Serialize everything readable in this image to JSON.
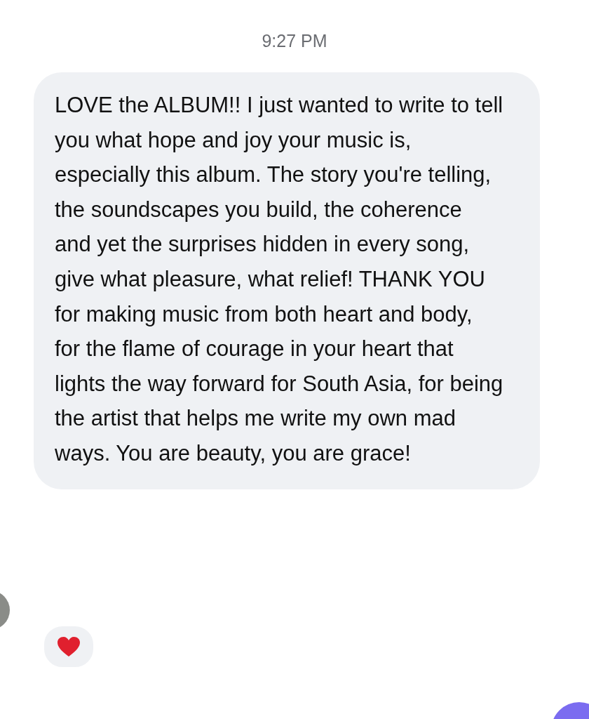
{
  "timestamp": "9:27 PM",
  "message": {
    "text": "LOVE the ALBUM!! I just wanted to write to tell you what hope and joy your music is, especially this album. The story you're telling, the soundscapes you build, the coherence and yet the surprises hidden in every song, give what pleasure, what relief! THANK YOU for making music from both heart and body, for the flame of courage in your heart that lights the way forward for South Asia, for being the artist that helps me write my own mad ways. You are beauty, you are grace!"
  }
}
